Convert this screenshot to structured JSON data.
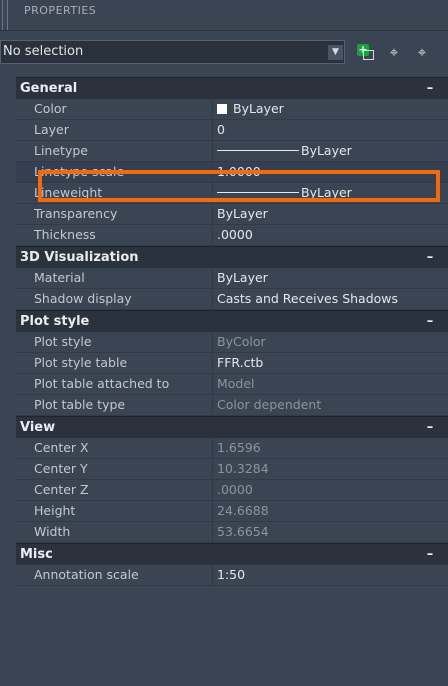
{
  "panel": {
    "title": "PROPERTIES"
  },
  "toolbar": {
    "selection_value": "No selection",
    "dropdown_icon": "chevron-down-icon",
    "quick_select_icon": "quick-select-icon",
    "select_objects_icon": "select-objects-icon",
    "toggle_pickadd_icon": "toggle-pickadd-icon"
  },
  "categories": {
    "general": {
      "title": "General",
      "collapse": "–",
      "rows": [
        {
          "name": "Color",
          "value": "ByLayer"
        },
        {
          "name": "Layer",
          "value": "0"
        },
        {
          "name": "Linetype",
          "value": "ByLayer"
        },
        {
          "name": "Linetype scale",
          "value": "1.0000"
        },
        {
          "name": "Lineweight",
          "value": "ByLayer"
        },
        {
          "name": "Transparency",
          "value": "ByLayer"
        },
        {
          "name": "Thickness",
          "value": ".0000"
        }
      ]
    },
    "visualization": {
      "title": "3D Visualization",
      "collapse": "–",
      "rows": [
        {
          "name": "Material",
          "value": "ByLayer"
        },
        {
          "name": "Shadow display",
          "value": "Casts and Receives Shadows"
        }
      ]
    },
    "plot_style": {
      "title": "Plot style",
      "collapse": "–",
      "rows": [
        {
          "name": "Plot style",
          "value": "ByColor"
        },
        {
          "name": "Plot style table",
          "value": "FFR.ctb"
        },
        {
          "name": "Plot table attached to",
          "value": "Model"
        },
        {
          "name": "Plot table type",
          "value": "Color dependent"
        }
      ]
    },
    "view": {
      "title": "View",
      "collapse": "–",
      "rows": [
        {
          "name": "Center X",
          "value": "1.6596"
        },
        {
          "name": "Center Y",
          "value": "10.3284"
        },
        {
          "name": "Center Z",
          "value": ".0000"
        },
        {
          "name": "Height",
          "value": "24.6688"
        },
        {
          "name": "Width",
          "value": "53.6654"
        }
      ]
    },
    "misc": {
      "title": "Misc",
      "collapse": "–",
      "rows": [
        {
          "name": "Annotation scale",
          "value": "1:50"
        }
      ]
    }
  },
  "colors": {
    "highlight": "#f26a10",
    "color_swatch": "#ffffff"
  }
}
